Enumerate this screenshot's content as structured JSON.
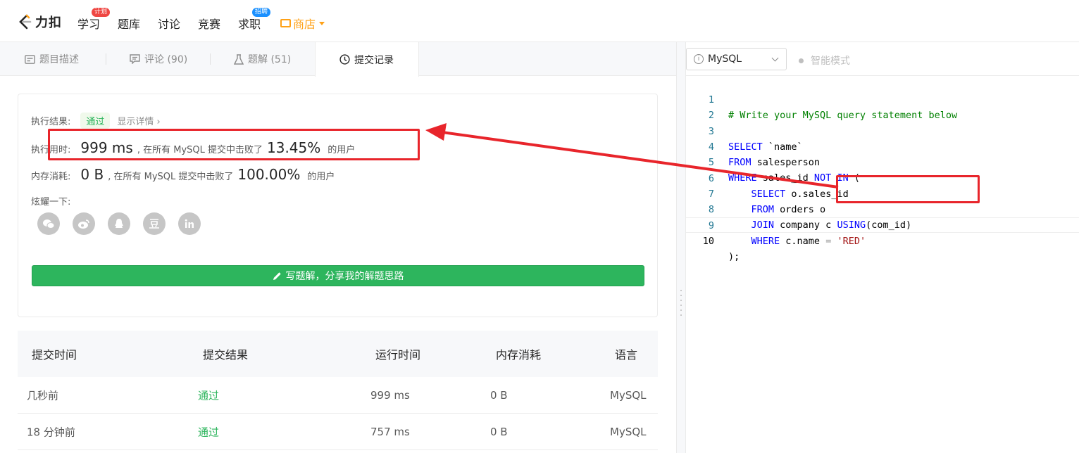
{
  "nav": {
    "logo_text": "力扣",
    "items": [
      {
        "label": "学习",
        "badge": "计划"
      },
      {
        "label": "题库"
      },
      {
        "label": "讨论"
      },
      {
        "label": "竞赛"
      },
      {
        "label": "求职",
        "badge": "招聘"
      }
    ],
    "shop_label": "商店"
  },
  "tabs": [
    {
      "label": "题目描述"
    },
    {
      "label": "评论 (90)"
    },
    {
      "label": "题解 (51)"
    },
    {
      "label": "提交记录",
      "active": true
    }
  ],
  "result": {
    "status_label": "执行结果:",
    "status_value": "通过",
    "detail_link": "显示详情 ›",
    "time_label": "执行用时:",
    "time_value": "999 ms",
    "time_mid": ", 在所有 MySQL 提交中击败了",
    "time_pct": "13.45%",
    "time_tail": "的用户",
    "mem_label": "内存消耗:",
    "mem_value": "0 B",
    "mem_mid": ", 在所有 MySQL 提交中击败了",
    "mem_pct": "100.00%",
    "mem_tail": "的用户",
    "share_label": "炫耀一下:",
    "share_icons": [
      "wechat-icon",
      "weibo-icon",
      "qq-icon",
      "douban-icon",
      "linkedin-icon"
    ],
    "write_button": "写题解，分享我的解题思路"
  },
  "table": {
    "headers": [
      "提交时间",
      "提交结果",
      "运行时间",
      "内存消耗",
      "语言"
    ],
    "rows": [
      [
        "几秒前",
        "通过",
        "999 ms",
        "0 B",
        "MySQL"
      ],
      [
        "18 分钟前",
        "通过",
        "757 ms",
        "0 B",
        "MySQL"
      ]
    ]
  },
  "editor": {
    "language": "MySQL",
    "smart_mode": "智能模式",
    "line_numbers": [
      "1",
      "2",
      "3",
      "4",
      "5",
      "6",
      "7",
      "8",
      "9",
      "10"
    ],
    "lines": [
      "# Write your MySQL query statement below",
      "",
      "SELECT `name`",
      "FROM salesperson",
      "WHERE sales_id NOT IN (",
      "    SELECT o.sales_id",
      "    FROM orders o",
      "    JOIN company c USING(com_id)",
      "    WHERE c.name = 'RED'",
      ");"
    ]
  },
  "colors": {
    "accent_green": "#2db55d",
    "shop_orange": "#ffa116",
    "annotation_red": "#e8252b"
  }
}
